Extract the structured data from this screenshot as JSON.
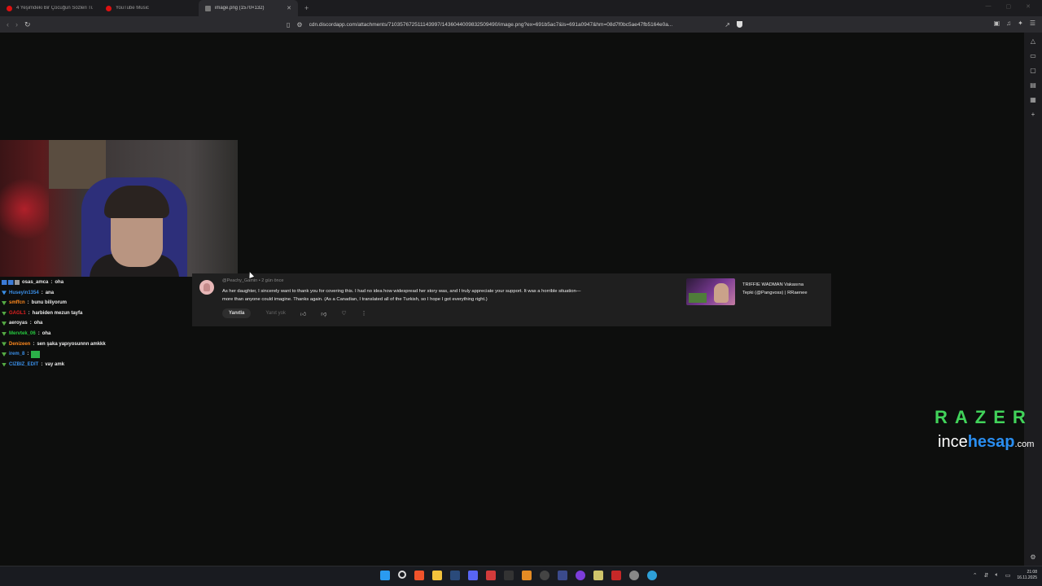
{
  "browser": {
    "tabs": [
      {
        "label": "4 Yeşimdeki Bir Çocuğun Sözleri Tüm",
        "active": false
      },
      {
        "label": "YouTube Music",
        "active": false
      },
      {
        "label": "image.png (1570×132)",
        "active": true
      }
    ],
    "new_tab": "+",
    "url": "cdn.discordapp.com/attachments/710357672511143997/1436044009832509490/image.png?ex=691b5ac7&is=691a0947&hm=08d7f0bc5ae47fb5164e0a..."
  },
  "chat": [
    {
      "user": "osas_amca",
      "color": "#e8e8e8",
      "text": "oha",
      "badges": "multi"
    },
    {
      "user": "Huseyin1354",
      "color": "#3a8fe8",
      "text": "ana",
      "badges": "green"
    },
    {
      "user": "smffcn",
      "color": "#ff8a1e",
      "text": "bunu biliyorum",
      "badges": "green"
    },
    {
      "user": "GAGL1",
      "color": "#e02020",
      "text": "harbiden mezun tayfa",
      "badges": "green"
    },
    {
      "user": "aeroyas",
      "color": "#e8e8e8",
      "text": "oha",
      "badges": "green"
    },
    {
      "user": "Mervtek_06",
      "color": "#27c93f",
      "text": "oha",
      "badges": "green"
    },
    {
      "user": "Denizeen",
      "color": "#ff8a1e",
      "text": "sen şaka yapıyosunnn amkkk",
      "badges": "green"
    },
    {
      "user": "irem_8",
      "color": "#3a8fe8",
      "text": "",
      "badges": "green",
      "emote": true
    },
    {
      "user": "CIZBIZ_EDIT",
      "color": "#3a8fe8",
      "text": "vay amk",
      "badges": "green"
    }
  ],
  "comment": {
    "author": "@Peachy_Gamin",
    "time": "2 gün önce",
    "text": "As her daughter, I sincerely want to thank you for covering this. I had no idea how widespread her story was, and I truly appreciate your support. It was a horrible situation—more than anyone could imagine. Thanks again. (As a Canadian, I translated all of the Turkish, so I hope I got everything right.)",
    "reply_label": "Yanıtla",
    "no_reply_label": "Yanıt yok",
    "recommended_title": "TRIFFIE WADMAN Vakasına Tepki (@Pangvoss) | RRaenee"
  },
  "overlay": {
    "razer": "RAZER",
    "incehesap_a": "ince",
    "incehesap_b": "hesap",
    "incehesap_c": ".com"
  },
  "clock": {
    "time": "21:08",
    "date": "16.11.2025"
  }
}
